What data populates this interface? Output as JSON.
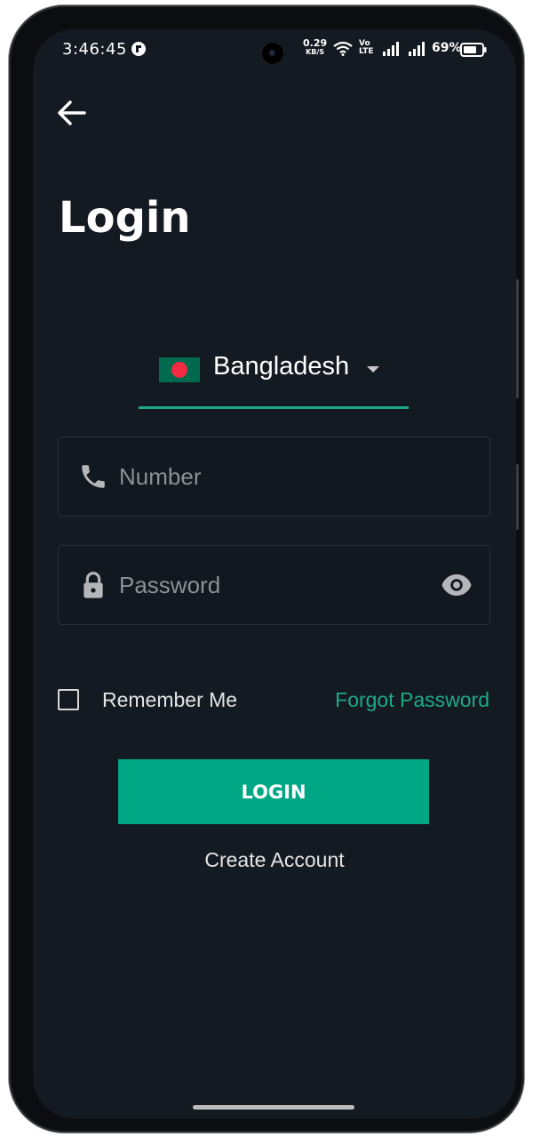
{
  "status_bar": {
    "time": "3:46:45",
    "net_speed": "0.29",
    "net_speed_unit": "KB/S",
    "volte_top": "Vo",
    "volte_bottom": "LTE",
    "battery_percent": "69%"
  },
  "page": {
    "title": "Login"
  },
  "country_select": {
    "selected": "Bangladesh"
  },
  "number_field": {
    "placeholder": "Number",
    "value": ""
  },
  "password_field": {
    "placeholder": "Password",
    "value": ""
  },
  "remember": {
    "label": "Remember Me",
    "checked": false
  },
  "forgot_password": "Forgot Password",
  "login_button": "LOGIN",
  "create_account": "Create Account",
  "colors": {
    "background": "#141a21",
    "accent": "#00a784",
    "link": "#1ea889",
    "field_bg": "#121820"
  },
  "icons": [
    "back-arrow-icon",
    "phone-icon",
    "lock-icon",
    "eye-icon",
    "dropdown-arrow-icon",
    "flag-bangladesh-icon"
  ]
}
